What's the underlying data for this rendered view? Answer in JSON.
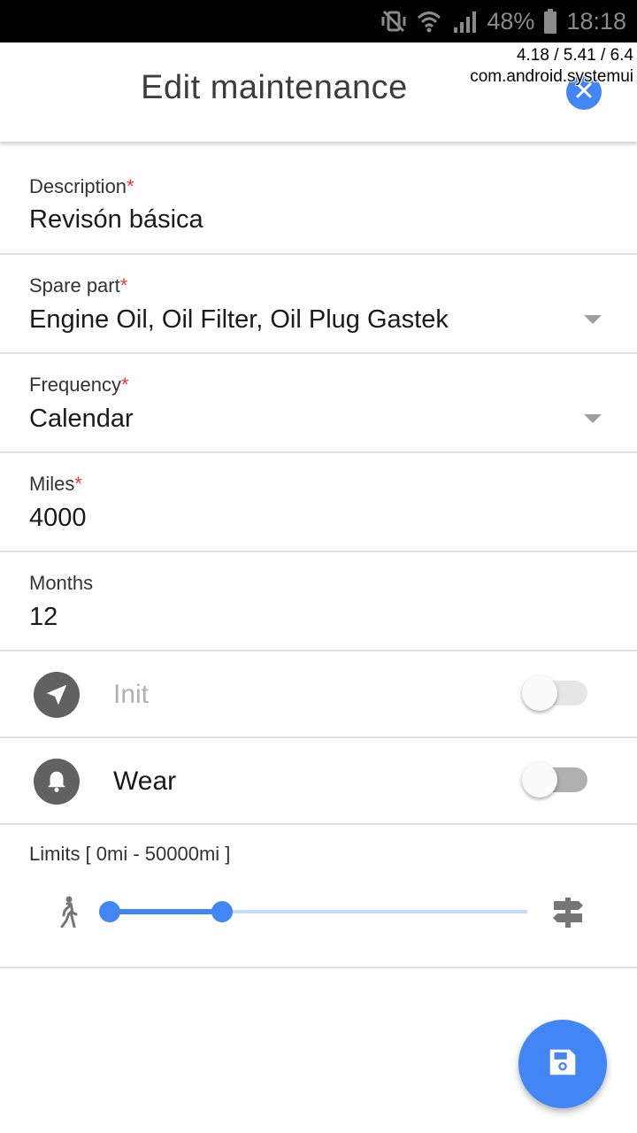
{
  "status_bar": {
    "battery": "48%",
    "time": "18:18"
  },
  "overlay": {
    "line1": "4.18 / 5.41 / 6.4",
    "line2": "com.android.systemui"
  },
  "app_bar": {
    "title": "Edit maintenance"
  },
  "form": {
    "description": {
      "label": "Description",
      "required": "*",
      "value": "Revisón básica"
    },
    "spare_part": {
      "label": "Spare part",
      "required": "*",
      "value": "Engine Oil, Oil Filter, Oil Plug Gastek"
    },
    "frequency": {
      "label": "Frequency",
      "required": "*",
      "value": "Calendar"
    },
    "miles": {
      "label": "Miles",
      "required": "*",
      "value": "4000"
    },
    "months": {
      "label": "Months",
      "value": "12"
    }
  },
  "toggles": {
    "init": {
      "label": "Init",
      "enabled": false,
      "on": false
    },
    "wear": {
      "label": "Wear",
      "enabled": true,
      "on": false
    }
  },
  "limits": {
    "label": "Limits [ 0mi - 50000mi ]",
    "min": 0,
    "max": 50000,
    "low_fraction": 0.0,
    "high_fraction": 0.27
  },
  "colors": {
    "accent": "#4285f4",
    "required": "#e53935",
    "track_light": "#c6dafc"
  }
}
